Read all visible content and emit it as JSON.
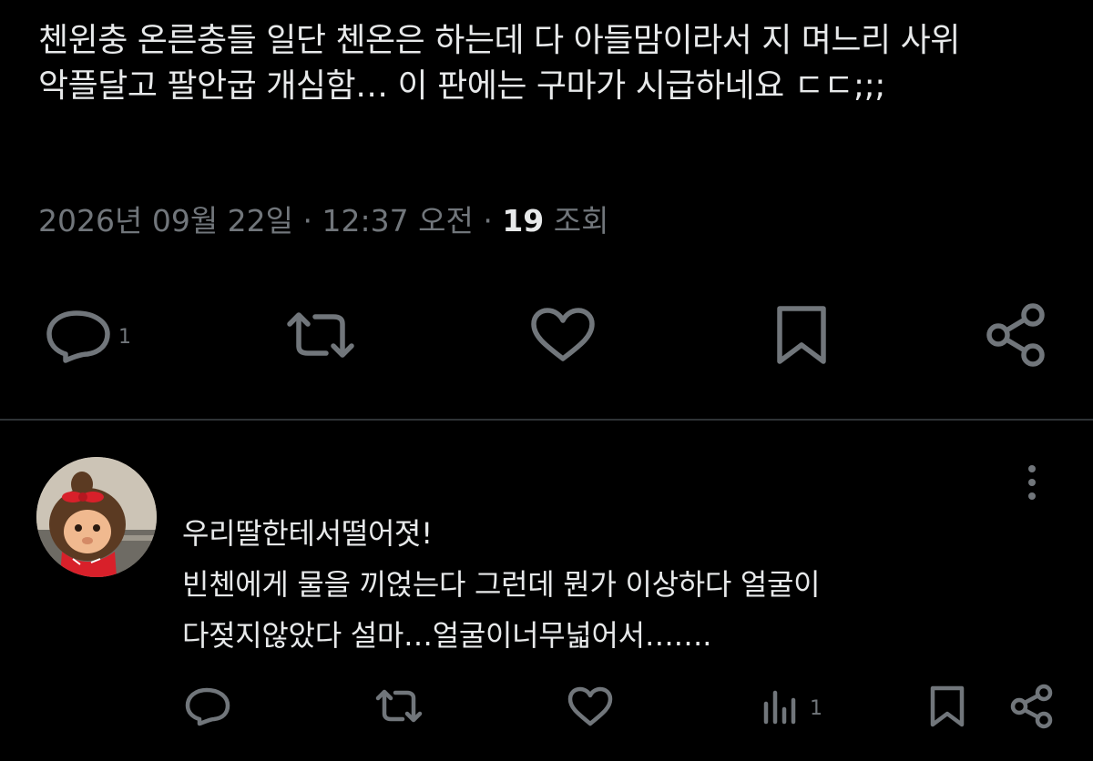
{
  "tweet": {
    "text": "첸윈충 온른충들 일단 첸온은 하는데 다 아들맘이라서 지 며느리 사위 악플달고 팔안굽 개심함… 이 판에는 구마가 시급하네요 ㄷㄷ;;;",
    "meta": {
      "date": "2026년 09월 22일",
      "sep1": " · ",
      "time": "12:37 오전",
      "sep2": " · ",
      "views_count": "19",
      "views_label": " 조회"
    },
    "actions": {
      "reply_count": "1",
      "icons": [
        "reply-icon",
        "retweet-icon",
        "like-icon",
        "bookmark-icon",
        "share-icon"
      ]
    }
  },
  "reply": {
    "lines": [
      "우리딸한테서떨어졋!",
      "빈첸에게 물을 끼얹는다 그런데 뭔가 이상하다 얼굴이",
      "다젖지않았다 설마…얼굴이너무넓어서……."
    ],
    "actions": {
      "views_count": "1",
      "icons": [
        "reply-icon",
        "retweet-icon",
        "like-icon",
        "views-icon",
        "bookmark-icon",
        "share-icon"
      ]
    }
  },
  "colors": {
    "background": "#000000",
    "text": "#e7e9ea",
    "muted": "#71767b",
    "divider": "#2f3336"
  }
}
